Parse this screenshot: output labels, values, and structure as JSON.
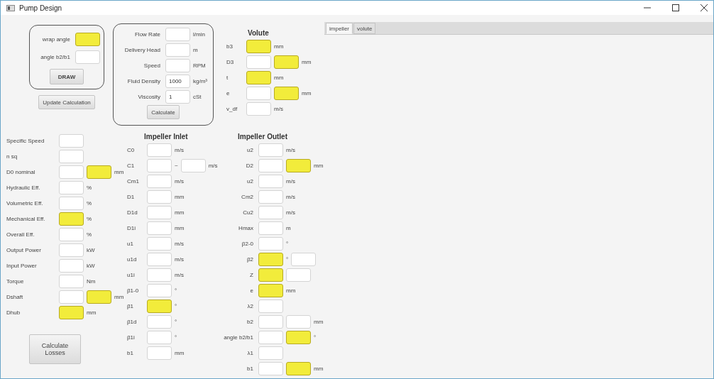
{
  "window": {
    "title": "Pump Design"
  },
  "draw_panel": {
    "rows": [
      {
        "label": "wrap angle",
        "items": [
          {
            "kind": "field",
            "highlighted": true
          }
        ]
      },
      {
        "label": "angle b2/b1",
        "items": [
          {
            "kind": "field",
            "highlighted": false
          }
        ]
      }
    ],
    "button": "DRAW"
  },
  "update_button": "Update Calculation",
  "input_panel": {
    "rows": [
      {
        "label": "Flow Rate",
        "items": [
          {
            "kind": "field",
            "highlighted": false
          },
          {
            "kind": "unit",
            "text": "l/min"
          }
        ]
      },
      {
        "label": "Delivery Head",
        "items": [
          {
            "kind": "field",
            "highlighted": false
          },
          {
            "kind": "unit",
            "text": "m"
          }
        ]
      },
      {
        "label": "Speed",
        "items": [
          {
            "kind": "field",
            "highlighted": false
          },
          {
            "kind": "unit",
            "text": "RPM"
          }
        ]
      },
      {
        "label": "Fluid Density",
        "items": [
          {
            "kind": "field",
            "highlighted": false,
            "value": "1000"
          },
          {
            "kind": "unit",
            "text": "kg/m³"
          }
        ]
      },
      {
        "label": "Viscosity",
        "items": [
          {
            "kind": "field",
            "highlighted": false,
            "value": "1"
          },
          {
            "kind": "unit",
            "text": "cSt"
          }
        ]
      }
    ],
    "button": "Calculate"
  },
  "volute": {
    "title": "Volute",
    "rows": [
      {
        "label": "b3",
        "items": [
          {
            "kind": "field",
            "highlighted": true
          },
          {
            "kind": "unit",
            "text": "mm"
          }
        ]
      },
      {
        "label": "D3",
        "items": [
          {
            "kind": "field",
            "highlighted": false
          },
          {
            "kind": "field",
            "highlighted": true
          },
          {
            "kind": "unit",
            "text": "mm"
          }
        ]
      },
      {
        "label": "t",
        "items": [
          {
            "kind": "field",
            "highlighted": true
          },
          {
            "kind": "unit",
            "text": "mm"
          }
        ]
      },
      {
        "label": "e",
        "items": [
          {
            "kind": "field",
            "highlighted": false
          },
          {
            "kind": "field",
            "highlighted": true
          },
          {
            "kind": "unit",
            "text": "mm"
          }
        ]
      },
      {
        "label": "v_df",
        "items": [
          {
            "kind": "field",
            "highlighted": false
          },
          {
            "kind": "unit",
            "text": "m/s"
          }
        ]
      }
    ]
  },
  "tabs": [
    {
      "label": "impeller",
      "selected": true
    },
    {
      "label": "volute",
      "selected": false
    }
  ],
  "results": {
    "rows": [
      {
        "label": "Specific Speed",
        "items": [
          {
            "kind": "field",
            "highlighted": false
          }
        ]
      },
      {
        "label": "n sq",
        "items": [
          {
            "kind": "field",
            "highlighted": false
          }
        ]
      },
      {
        "label": "D0 nominal",
        "items": [
          {
            "kind": "field",
            "highlighted": false
          },
          {
            "kind": "field",
            "highlighted": true
          },
          {
            "kind": "unit",
            "text": "mm"
          }
        ]
      },
      {
        "label": "Hydraulic Eff.",
        "items": [
          {
            "kind": "field",
            "highlighted": false
          },
          {
            "kind": "unit",
            "text": "%"
          }
        ]
      },
      {
        "label": "Volumetric Eff.",
        "items": [
          {
            "kind": "field",
            "highlighted": false
          },
          {
            "kind": "unit",
            "text": "%"
          }
        ]
      },
      {
        "label": "Mechanical Eff.",
        "items": [
          {
            "kind": "field",
            "highlighted": true
          },
          {
            "kind": "unit",
            "text": "%"
          }
        ]
      },
      {
        "label": "Overall Eff.",
        "items": [
          {
            "kind": "field",
            "highlighted": false
          },
          {
            "kind": "unit",
            "text": "%"
          }
        ]
      },
      {
        "label": "Output Power",
        "items": [
          {
            "kind": "field",
            "highlighted": false
          },
          {
            "kind": "unit",
            "text": "kW"
          }
        ]
      },
      {
        "label": "Input Power",
        "items": [
          {
            "kind": "field",
            "highlighted": false
          },
          {
            "kind": "unit",
            "text": "kW"
          }
        ]
      },
      {
        "label": "Torque",
        "items": [
          {
            "kind": "field",
            "highlighted": false
          },
          {
            "kind": "unit",
            "text": "Nm"
          }
        ]
      },
      {
        "label": "Dshaft",
        "items": [
          {
            "kind": "field",
            "highlighted": false
          },
          {
            "kind": "field",
            "highlighted": true
          },
          {
            "kind": "unit",
            "text": "mm"
          }
        ]
      },
      {
        "label": "Dhub",
        "items": [
          {
            "kind": "field",
            "highlighted": true
          },
          {
            "kind": "unit",
            "text": "mm"
          }
        ]
      }
    ]
  },
  "calc_losses_button": "Calculate Losses",
  "impeller_inlet": {
    "title": "Impeller Inlet",
    "rows": [
      {
        "label": "C0",
        "items": [
          {
            "kind": "field",
            "highlighted": false
          },
          {
            "kind": "unit",
            "text": "m/s"
          }
        ]
      },
      {
        "label": "C1",
        "items": [
          {
            "kind": "field",
            "highlighted": false
          },
          {
            "kind": "sep",
            "text": "~"
          },
          {
            "kind": "field",
            "highlighted": false
          },
          {
            "kind": "unit",
            "text": "m/s"
          }
        ]
      },
      {
        "label": "Cm1",
        "items": [
          {
            "kind": "field",
            "highlighted": false
          },
          {
            "kind": "unit",
            "text": "m/s"
          }
        ]
      },
      {
        "label": "D1",
        "items": [
          {
            "kind": "field",
            "highlighted": false
          },
          {
            "kind": "unit",
            "text": "mm"
          }
        ]
      },
      {
        "label": "D1d",
        "items": [
          {
            "kind": "field",
            "highlighted": false
          },
          {
            "kind": "unit",
            "text": "mm"
          }
        ]
      },
      {
        "label": "D1i",
        "items": [
          {
            "kind": "field",
            "highlighted": false
          },
          {
            "kind": "unit",
            "text": "mm"
          }
        ]
      },
      {
        "label": "u1",
        "items": [
          {
            "kind": "field",
            "highlighted": false
          },
          {
            "kind": "unit",
            "text": "m/s"
          }
        ]
      },
      {
        "label": "u1d",
        "items": [
          {
            "kind": "field",
            "highlighted": false
          },
          {
            "kind": "unit",
            "text": "m/s"
          }
        ]
      },
      {
        "label": "u1i",
        "items": [
          {
            "kind": "field",
            "highlighted": false
          },
          {
            "kind": "unit",
            "text": "m/s"
          }
        ]
      },
      {
        "label": "β1-0",
        "items": [
          {
            "kind": "field",
            "highlighted": false
          },
          {
            "kind": "sep",
            "text": "°"
          }
        ]
      },
      {
        "label": "β1",
        "items": [
          {
            "kind": "field",
            "highlighted": true
          },
          {
            "kind": "sep",
            "text": "°"
          }
        ]
      },
      {
        "label": "β1d",
        "items": [
          {
            "kind": "field",
            "highlighted": false
          },
          {
            "kind": "sep",
            "text": "°"
          }
        ]
      },
      {
        "label": "β1i",
        "items": [
          {
            "kind": "field",
            "highlighted": false
          },
          {
            "kind": "sep",
            "text": "°"
          }
        ]
      },
      {
        "label": "b1",
        "items": [
          {
            "kind": "field",
            "highlighted": false
          },
          {
            "kind": "unit",
            "text": "mm"
          }
        ]
      }
    ]
  },
  "impeller_outlet": {
    "title": "Impeller Outlet",
    "rows": [
      {
        "label": "u2",
        "items": [
          {
            "kind": "field",
            "highlighted": false
          },
          {
            "kind": "unit",
            "text": "m/s"
          }
        ]
      },
      {
        "label": "D2",
        "items": [
          {
            "kind": "field",
            "highlighted": false
          },
          {
            "kind": "field",
            "highlighted": true
          },
          {
            "kind": "unit",
            "text": "mm"
          }
        ]
      },
      {
        "label": "u2",
        "items": [
          {
            "kind": "field",
            "highlighted": false
          },
          {
            "kind": "unit",
            "text": "m/s"
          }
        ]
      },
      {
        "label": "Cm2",
        "items": [
          {
            "kind": "field",
            "highlighted": false
          },
          {
            "kind": "unit",
            "text": "m/s"
          }
        ]
      },
      {
        "label": "Cu2",
        "items": [
          {
            "kind": "field",
            "highlighted": false
          },
          {
            "kind": "unit",
            "text": "m/s"
          }
        ]
      },
      {
        "label": "Hmax",
        "items": [
          {
            "kind": "field",
            "highlighted": false
          },
          {
            "kind": "unit",
            "text": "m"
          }
        ]
      },
      {
        "label": "β2-0",
        "items": [
          {
            "kind": "field",
            "highlighted": false
          },
          {
            "kind": "sep",
            "text": "°"
          }
        ]
      },
      {
        "label": "β2",
        "items": [
          {
            "kind": "field",
            "highlighted": true
          },
          {
            "kind": "sep",
            "text": "°"
          },
          {
            "kind": "field",
            "highlighted": false
          }
        ]
      },
      {
        "label": "Z",
        "items": [
          {
            "kind": "field",
            "highlighted": true
          },
          {
            "kind": "field",
            "highlighted": false
          }
        ]
      },
      {
        "label": "e",
        "items": [
          {
            "kind": "field",
            "highlighted": true
          },
          {
            "kind": "unit",
            "text": "mm"
          }
        ]
      },
      {
        "label": "λ2",
        "items": [
          {
            "kind": "field",
            "highlighted": false
          }
        ]
      },
      {
        "label": "b2",
        "items": [
          {
            "kind": "field",
            "highlighted": false
          },
          {
            "kind": "field",
            "highlighted": false
          },
          {
            "kind": "unit",
            "text": "mm"
          }
        ]
      },
      {
        "label": "angle b2/b1",
        "items": [
          {
            "kind": "field",
            "highlighted": false
          },
          {
            "kind": "field",
            "highlighted": true
          },
          {
            "kind": "sep",
            "text": "°"
          }
        ]
      },
      {
        "label": "λ1",
        "items": [
          {
            "kind": "field",
            "highlighted": false
          }
        ]
      },
      {
        "label": "b1",
        "items": [
          {
            "kind": "field",
            "highlighted": false
          },
          {
            "kind": "field",
            "highlighted": true
          },
          {
            "kind": "unit",
            "text": "mm"
          }
        ]
      }
    ]
  }
}
